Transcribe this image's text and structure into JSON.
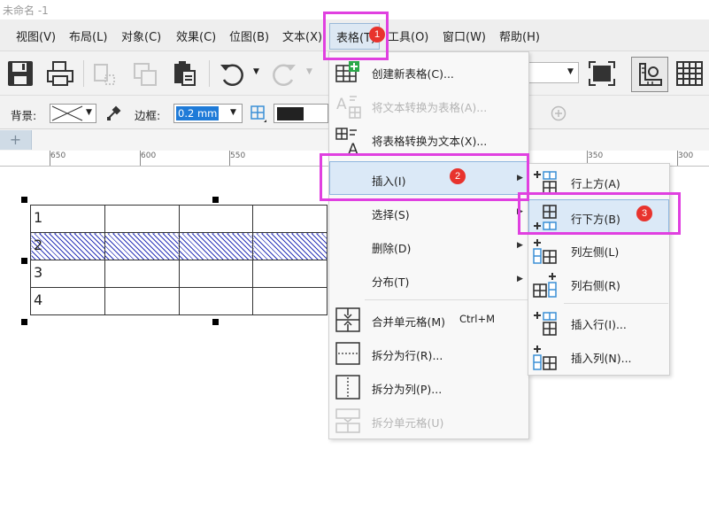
{
  "window": {
    "title": "未命名 -1"
  },
  "menubar": {
    "items": [
      "视图(V)",
      "布局(L)",
      "对象(C)",
      "效果(C)",
      "位图(B)",
      "文本(X)",
      "表格(T)",
      "工具(O)",
      "窗口(W)",
      "帮助(H)"
    ]
  },
  "toolbar2": {
    "bg_label": "背景:",
    "border_label": "边框:",
    "border_value": "0.2 mm"
  },
  "ruler": {
    "labels": [
      "650",
      "600",
      "550",
      "350",
      "300"
    ]
  },
  "table": {
    "rows": [
      "1",
      "2",
      "3",
      "4"
    ]
  },
  "table_menu": {
    "items": [
      {
        "label": "创建新表格(C)...",
        "disabled": false
      },
      {
        "label": "将文本转换为表格(A)...",
        "disabled": true
      },
      {
        "label": "将表格转换为文本(X)...",
        "disabled": false
      },
      {
        "label": "插入(I)",
        "disabled": false
      },
      {
        "label": "选择(S)",
        "disabled": false
      },
      {
        "label": "删除(D)",
        "disabled": false
      },
      {
        "label": "分布(T)",
        "disabled": false
      },
      {
        "label": "合并单元格(M)",
        "shortcut": "Ctrl+M",
        "disabled": false
      },
      {
        "label": "拆分为行(R)...",
        "disabled": false
      },
      {
        "label": "拆分为列(P)...",
        "disabled": false
      },
      {
        "label": "拆分单元格(U)",
        "disabled": true
      }
    ]
  },
  "insert_menu": {
    "items": [
      "行上方(A)",
      "行下方(B)",
      "列左侧(L)",
      "列右侧(R)",
      "插入行(I)...",
      "插入列(N)..."
    ]
  },
  "badges": [
    "1",
    "2",
    "3"
  ],
  "colors": {
    "accent": "#3a8fd6",
    "highlight": "#e040e0",
    "badge": "#e8332d",
    "green": "#2aa84a"
  }
}
